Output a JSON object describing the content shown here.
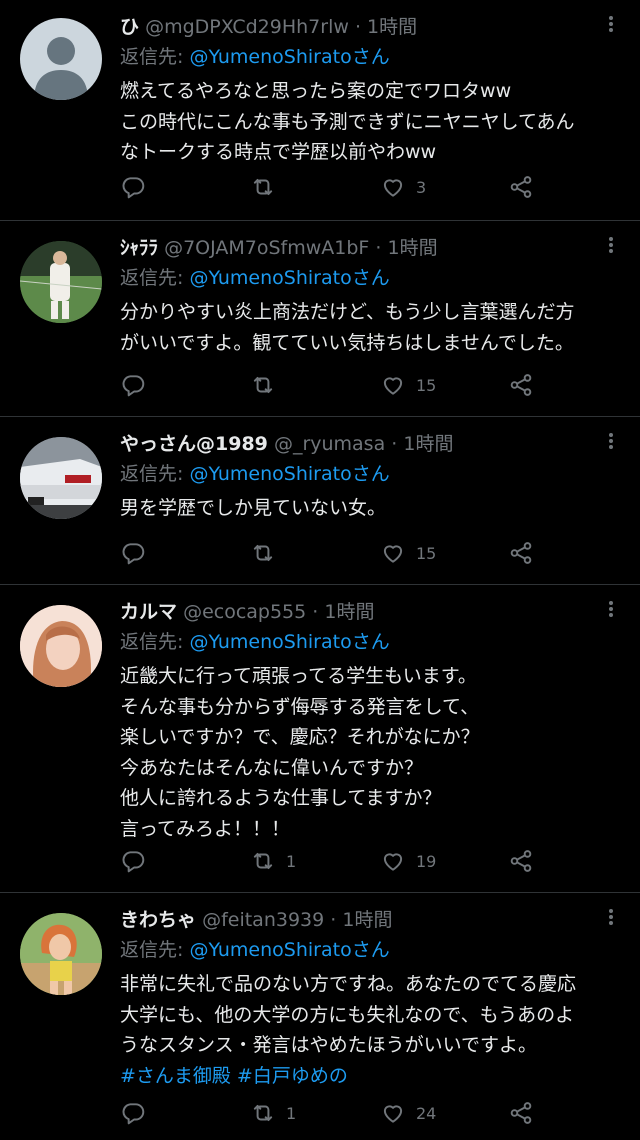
{
  "reply_prefix": "返信先: ",
  "tweets": [
    {
      "name": "ひ",
      "handle": "@mgDPXCd29Hh7rlw",
      "dot": "·",
      "time": "1時間",
      "reply_to": "@YumenoShiratoさん",
      "lines": [
        "燃えてるやろなと思ったら案の定でワロタww",
        "この時代にこんな事も予測できずにニヤニヤしてあん",
        "なトークする時点で学歴以前やわww"
      ],
      "retweets": "",
      "likes": "3"
    },
    {
      "name": "ｼｬﾗﾗ",
      "handle": "@7OJAM7oSfmwA1bF",
      "dot": "·",
      "time": "1時間",
      "reply_to": "@YumenoShiratoさん",
      "lines": [
        "分かりやすい炎上商法だけど、もう少し言葉選んだ方",
        "がいいですよ。観てていい気持ちはしませんでした。"
      ],
      "retweets": "",
      "likes": "15"
    },
    {
      "name": "やっさん@1989",
      "handle": "@_ryumasa",
      "dot": "·",
      "time": "1時間",
      "reply_to": "@YumenoShiratoさん",
      "lines": [
        "男を学歴でしか見ていない女。"
      ],
      "retweets": "",
      "likes": "15"
    },
    {
      "name": "カルマ",
      "handle": "@ecocap555",
      "dot": "·",
      "time": "1時間",
      "reply_to": "@YumenoShiratoさん",
      "lines": [
        "近畿大に行って頑張ってる学生もいます。",
        "そんな事も分からず侮辱する発言をして、",
        "楽しいですか？で、慶応？それがなにか？",
        "今あなたはそんなに偉いんですか？",
        "他人に誇れるような仕事してますか？",
        "言ってみろよ！！！"
      ],
      "retweets": "1",
      "likes": "19"
    },
    {
      "name": "きわちゃ",
      "handle": "@feitan3939",
      "dot": "·",
      "time": "1時間",
      "reply_to": "@YumenoShiratoさん",
      "lines": [
        "非常に失礼で品のない方ですね。あなたのでてる慶応",
        "大学にも、他の大学の方にも失礼なので、もうあのよ",
        "うなスタンス・発言はやめたほうがいいですよ。"
      ],
      "tags": [
        "#さんま御殿",
        "#白戸ゆめの"
      ],
      "retweets": "1",
      "likes": "24"
    }
  ]
}
